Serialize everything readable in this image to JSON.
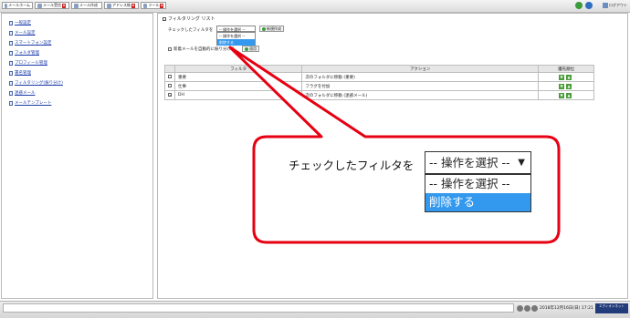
{
  "toolbar": {
    "items": [
      {
        "label": "メールホーム",
        "icon": "home-icon"
      },
      {
        "label": "メール受信",
        "icon": "inbox-icon"
      },
      {
        "label": "メール作成",
        "icon": "compose-icon"
      },
      {
        "label": "アドレス帳",
        "icon": "addressbook-icon"
      },
      {
        "label": "ツール",
        "icon": "tools-icon"
      }
    ],
    "logout_label": "ログアウト"
  },
  "sidebar": {
    "items": [
      {
        "label": "一般設定"
      },
      {
        "label": "メール設定"
      },
      {
        "label": "スマートフォン設定"
      },
      {
        "label": "フォルダ管理"
      },
      {
        "label": "プロフィール管理"
      },
      {
        "label": "署名管理"
      },
      {
        "label": "フィルタリング(振り分け)"
      },
      {
        "label": "迷惑メール"
      },
      {
        "label": "メールテンプレート"
      }
    ]
  },
  "main": {
    "title": "フィルタリング リスト",
    "checked_filter_label": "チェックしたフィルタを",
    "action_select": {
      "value": "-- 操作を選択 --",
      "options": [
        "-- 操作を選択 --",
        "削除する"
      ],
      "highlighted": "削除する"
    },
    "new_filter_button": "新規作成",
    "auto_apply_label": "新着メールを自動的に振り分ける",
    "apply_button": "適用",
    "table": {
      "headers": [
        "",
        "フィルタ",
        "アクション",
        "優先順位"
      ],
      "rows": [
        {
          "checked": false,
          "name": "重要",
          "action": "次のフォルダに移動 (重要)"
        },
        {
          "checked": false,
          "name": "仕事",
          "action": "フラグを付加"
        },
        {
          "checked": true,
          "name": "DH",
          "action": "次のフォルダに移動 (迷惑メール)"
        }
      ]
    }
  },
  "callout": {
    "label": "チェックしたフィルタを",
    "select_value": "-- 操作を選択 --",
    "options": [
      "-- 操作を選択 --",
      "削除する"
    ],
    "highlighted": "削除する",
    "border_color": "#e60012"
  },
  "statusbar": {
    "datetime": "2018年12月16日(日) 17:21",
    "logo_text": "エディオンネット"
  },
  "colors": {
    "link": "#1a3aa8",
    "highlight": "#3399ee",
    "callout_red": "#e60012"
  }
}
